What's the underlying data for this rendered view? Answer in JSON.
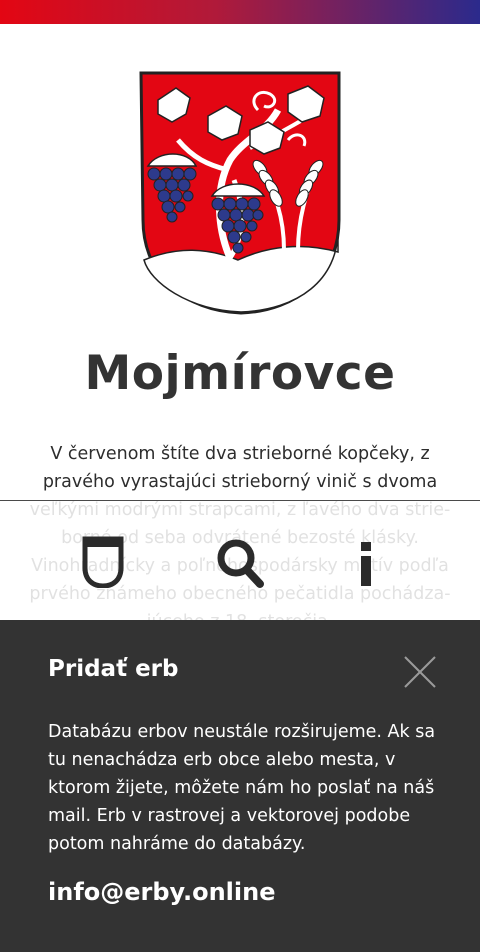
{
  "header": {
    "accent_gradient": [
      "#e30613",
      "#b01a3a",
      "#2b2a8c"
    ]
  },
  "crest": {
    "icon": "coat-of-arms-icon",
    "colors": {
      "field": "#e30613",
      "silver": "#ffffff",
      "grapes": "#2d3a8c",
      "outline": "#222222"
    }
  },
  "town": {
    "name": "Mojmírovce",
    "description": "V červenom štíte dva strieborné kopčeky, z pravého vyrastajúci strieborný vinič s dvoma veľkými modrými strapcami, z ľavého dva strie-borné od seba odvrátené bezosté klásky. Vinohradnícky a poľnohospodársky motív podľa prvého známeho obecného pečatidla pochádza-júceho z 18. storočia."
  },
  "toolbar": {
    "items": [
      {
        "name": "shield-icon"
      },
      {
        "name": "search-icon"
      },
      {
        "name": "info-icon"
      }
    ]
  },
  "panel": {
    "title": "Pridať erb",
    "text": "Databázu erbov neustále rozširujeme. Ak sa tu nenachádza erb obce alebo mesta, v ktorom žijete, môžete nám ho poslať na náš mail. Erb v rastrovej a vektorovej podobe potom nahráme do databázy.",
    "email": "info@erby.online",
    "close_icon": "close-icon",
    "background": "#333333"
  }
}
